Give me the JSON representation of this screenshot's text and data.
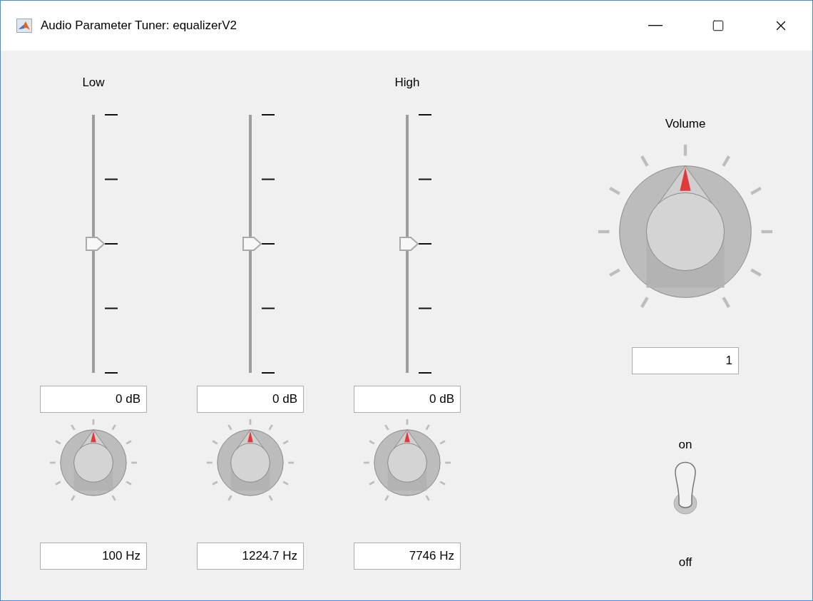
{
  "window": {
    "title": "Audio Parameter Tuner: equalizerV2"
  },
  "bands": [
    {
      "label": "Low",
      "gain": {
        "level": 0.5,
        "reading": "0 dB"
      },
      "frequency": {
        "level": 0.5,
        "reading": "100 Hz"
      }
    },
    {
      "gain": {
        "level": 0.5,
        "reading": "0 dB"
      },
      "frequency": {
        "level": 0.5,
        "reading": "1224.7 Hz"
      }
    },
    {
      "label": "High",
      "gain": {
        "level": 0.5,
        "reading": "0 dB"
      },
      "frequency": {
        "level": 0.5,
        "reading": "7746 Hz"
      }
    }
  ],
  "volume": {
    "label": "Volume",
    "level": 0.5,
    "reading": "1"
  },
  "power": {
    "on_label": "on",
    "off_label": "off",
    "on": true
  }
}
